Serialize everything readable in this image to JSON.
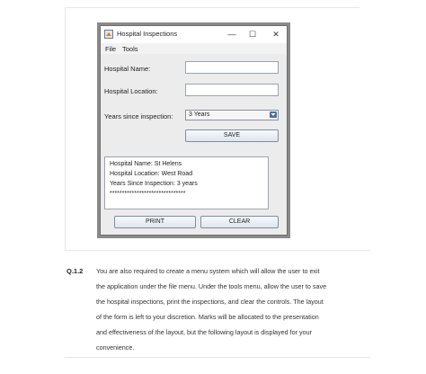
{
  "window": {
    "title": "Hospital Inspections",
    "controls": {
      "minimize": "—",
      "maximize": "☐",
      "close": "✕"
    }
  },
  "menu": {
    "items": [
      "File",
      "Tools"
    ]
  },
  "form": {
    "hospital_name_label": "Hospital Name:",
    "hospital_name_value": "",
    "hospital_location_label": "Hospital Location:",
    "hospital_location_value": "",
    "years_label": "Years since inspection:",
    "years_selected": "3 Years",
    "save_label": "SAVE"
  },
  "output": {
    "lines": [
      "Hospital Name: St Helens",
      "Hospital Location: West Road",
      "Years Since Inspection: 3 years",
      "*******************************"
    ]
  },
  "buttons": {
    "print_label": "PRINT",
    "clear_label": "CLEAR"
  },
  "document": {
    "question_number": "Q.1.2",
    "paragraph_lines": [
      "You are also required to create a menu system which will allow the user to exit",
      "the application under the file menu. Under the tools menu, allow the user to save",
      "the hospital inspections, print the inspections, and clear the controls. The layout",
      "of the form is left to your discretion. Marks will be allocated to the presentation",
      "and effectiveness of the layout, but the following layout is displayed for your",
      "convenience."
    ]
  }
}
